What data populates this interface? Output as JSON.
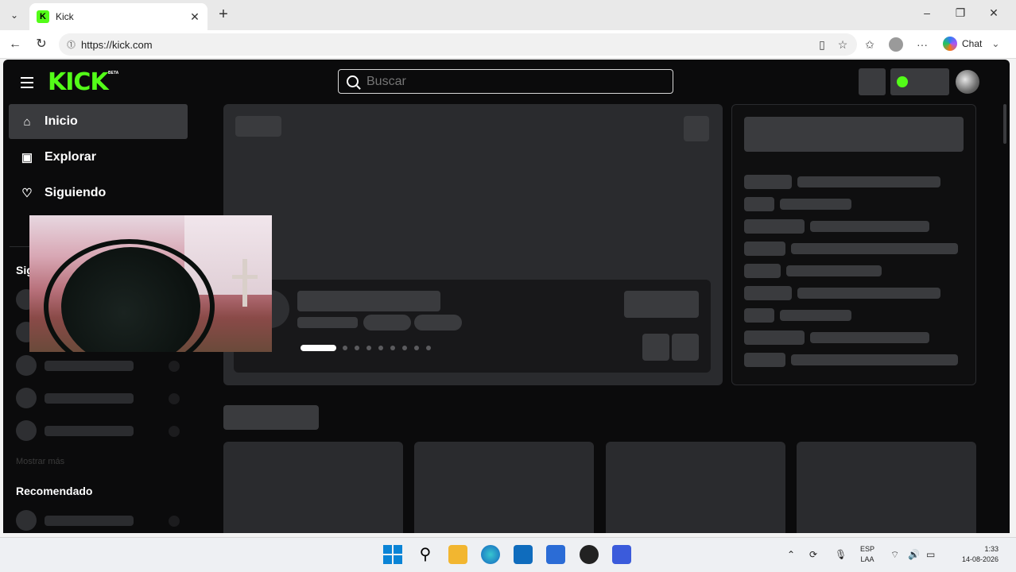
{
  "browser": {
    "tab_title": "Kick",
    "tab_favicon": "K",
    "new_tab_symbol": "+",
    "url": "https://kick.com",
    "chat_label": "Chat",
    "window_controls": {
      "minimize": "–",
      "restore": "❐",
      "close": "✕"
    }
  },
  "kick": {
    "logo_text": "KICK",
    "logo_badge": "BETA",
    "search_placeholder": "Buscar",
    "brand_color": "#53fc18",
    "sidebar": {
      "items": [
        {
          "label": "Inicio",
          "icon": "home-icon",
          "glyph": "⌂",
          "active": true
        },
        {
          "label": "Explorar",
          "icon": "browse-icon",
          "glyph": "▣",
          "active": false
        },
        {
          "label": "Siguiendo",
          "icon": "heart-icon",
          "glyph": "♡",
          "active": false
        }
      ],
      "following_section": "Siguiendo",
      "show_more": "Mostrar más",
      "recommended_section": "Recomendado"
    }
  },
  "taskbar": {
    "language": "ESP",
    "layout": "LAA",
    "time": "1:33",
    "date": "14-08-2026"
  }
}
